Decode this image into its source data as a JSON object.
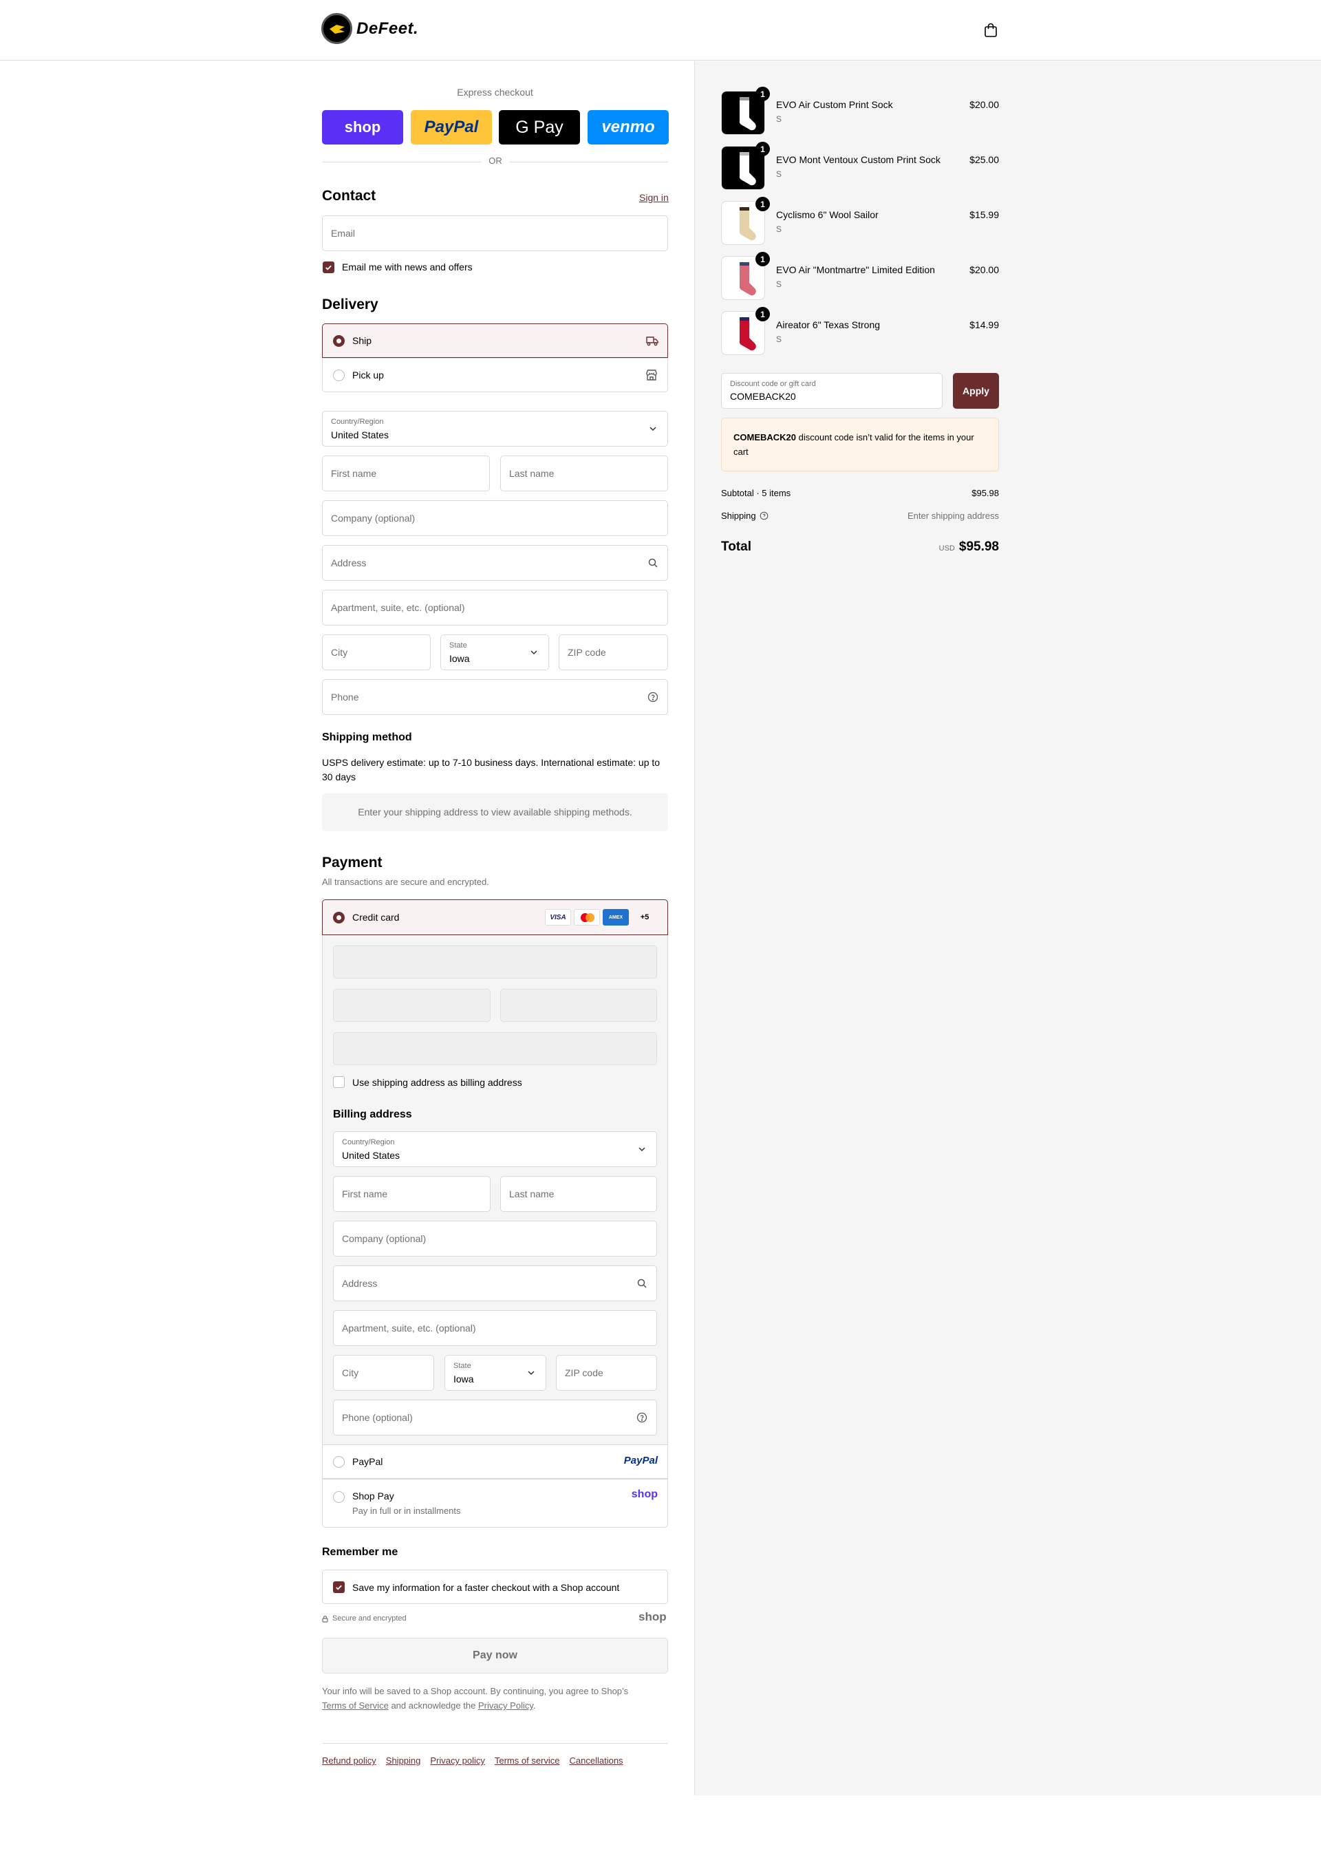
{
  "header": {
    "logo_text": "DeFeet.",
    "cart_icon": "shopping-bag-icon"
  },
  "express": {
    "title": "Express checkout",
    "shop_label": "shop",
    "paypal_label": "PayPal",
    "gpay_label": "G Pay",
    "venmo_label": "venmo",
    "or_label": "OR"
  },
  "contact": {
    "title": "Contact",
    "sign_in": "Sign in",
    "email_placeholder": "Email",
    "news_label": "Email me with news and offers",
    "news_checked": true
  },
  "delivery": {
    "title": "Delivery",
    "ship_label": "Ship",
    "pickup_label": "Pick up",
    "selected": "ship",
    "country_label": "Country/Region",
    "country_value": "United States",
    "first_name": "First name",
    "last_name": "Last name",
    "company": "Company (optional)",
    "address": "Address",
    "apartment": "Apartment, suite, etc. (optional)",
    "city": "City",
    "state_label": "State",
    "state_value": "Iowa",
    "zip": "ZIP code",
    "phone": "Phone"
  },
  "shipping_method": {
    "title": "Shipping method",
    "note": "USPS delivery estimate: up to 7-10 business days. International estimate: up to 30 days",
    "empty_message": "Enter your shipping address to view available shipping methods."
  },
  "payment": {
    "title": "Payment",
    "subtitle": "All transactions are secure and encrypted.",
    "credit_card_label": "Credit card",
    "card_brands": [
      "VISA",
      "mastercard",
      "AMEX"
    ],
    "more_brands": "+5",
    "use_shipping_label": "Use shipping address as billing address",
    "use_shipping_checked": false,
    "paypal_label": "PayPal",
    "paypal_logo": "PayPal",
    "shoppay_label": "Shop Pay",
    "shoppay_sub": "Pay in full or in installments",
    "shoppay_logo": "shop"
  },
  "billing": {
    "title": "Billing address",
    "country_label": "Country/Region",
    "country_value": "United States",
    "first_name": "First name",
    "last_name": "Last name",
    "company": "Company (optional)",
    "address": "Address",
    "apartment": "Apartment, suite, etc. (optional)",
    "city": "City",
    "state_label": "State",
    "state_value": "Iowa",
    "zip": "ZIP code",
    "phone": "Phone (optional)"
  },
  "remember": {
    "title": "Remember me",
    "save_label": "Save my information for a faster checkout with a Shop account",
    "save_checked": true,
    "secure_label": "Secure and encrypted",
    "shop_logo": "shop"
  },
  "pay_now": "Pay now",
  "legal": {
    "prefix": "Your info will be saved to a Shop account. By continuing, you agree to Shop’s",
    "tos": "Terms of Service",
    "middle": "and acknowledge the",
    "privacy": "Privacy Policy",
    "suffix": "."
  },
  "footer_links": [
    "Refund policy",
    "Shipping",
    "Privacy policy",
    "Terms of service",
    "Cancellations"
  ],
  "summary": {
    "items": [
      {
        "name": "EVO Air Custom Print Sock",
        "variant": "S",
        "price": "$20.00",
        "qty": "1"
      },
      {
        "name": "EVO Mont Ventoux Custom Print Sock",
        "variant": "S",
        "price": "$25.00",
        "qty": "1"
      },
      {
        "name": "Cyclismo 6\" Wool Sailor",
        "variant": "S",
        "price": "$15.99",
        "qty": "1"
      },
      {
        "name": "EVO Air \"Montmartre\" Limited Edition",
        "variant": "S",
        "price": "$20.00",
        "qty": "1"
      },
      {
        "name": "Aireator 6\" Texas Strong",
        "variant": "S",
        "price": "$14.99",
        "qty": "1"
      }
    ],
    "discount_label": "Discount code or gift card",
    "discount_value": "COMEBACK20",
    "apply_label": "Apply",
    "error_code": "COMEBACK20",
    "error_text": "discount code isn’t valid for the items in your cart",
    "subtotal_label": "Subtotal · 5 items",
    "subtotal_value": "$95.98",
    "shipping_label": "Shipping",
    "shipping_value": "Enter shipping address",
    "total_label": "Total",
    "currency": "USD",
    "total_value": "$95.98"
  },
  "colors": {
    "accent": "#6b2d2d",
    "shop_purple": "#5a31f4",
    "paypal_yellow": "#ffc439",
    "venmo_blue": "#008cff",
    "error_bg": "#fff4e8"
  }
}
